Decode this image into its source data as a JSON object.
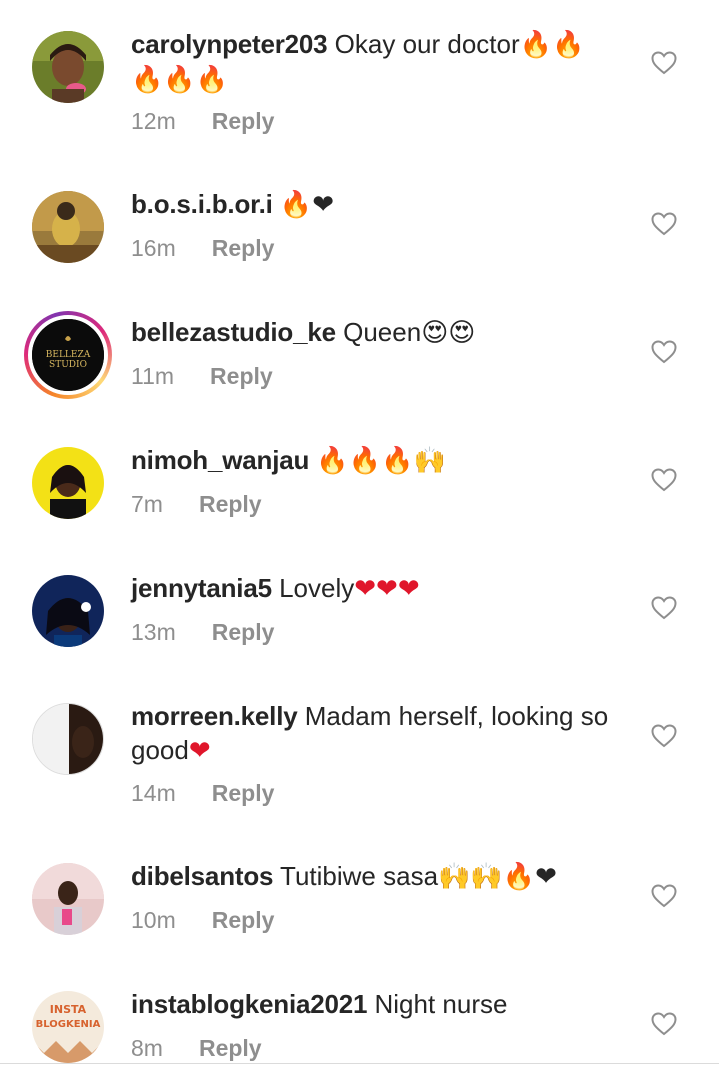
{
  "icons": {
    "like": "heart-outline-icon",
    "fire": "🔥",
    "red_heart": "❤",
    "heart_eyes": "😍",
    "raising_hands": "🙌"
  },
  "colors": {
    "username": "#262626",
    "secondary": "#8e8e8e",
    "heart_red": "#e0162b",
    "fire_orange": "#f7931e"
  },
  "comments": [
    {
      "username": "carolynpeter203",
      "text": " Okay our doctor",
      "emojis_line1": "🔥🔥",
      "emojis_line2": "🔥🔥🔥",
      "time": "12m",
      "reply": "Reply"
    },
    {
      "username": "b.o.s.i.b.or.i",
      "text": " ",
      "emojis": "🔥❤",
      "time": "16m",
      "reply": "Reply"
    },
    {
      "username": "bellezastudio_ke",
      "text": " Queen",
      "emojis": "😍😍",
      "avatar_text_1": "BELLEZA",
      "avatar_text_2": "STUDIO",
      "time": "11m",
      "reply": "Reply"
    },
    {
      "username": "nimoh_wanjau",
      "text": " ",
      "emojis": "🔥🔥🔥🙌",
      "time": "7m",
      "reply": "Reply"
    },
    {
      "username": "jennytania5",
      "text": " Lovely",
      "emojis": "❤❤❤",
      "time": "13m",
      "reply": "Reply"
    },
    {
      "username": "morreen.kelly",
      "text": " Madam herself, looking so good",
      "emojis": "❤",
      "time": "14m",
      "reply": "Reply"
    },
    {
      "username": "dibelsantos",
      "text": " Tutibiwe sasa",
      "emojis": "🙌🙌🔥❤",
      "time": "10m",
      "reply": "Reply"
    },
    {
      "username": "instablogkenia2021",
      "text": " Night nurse",
      "avatar_text_1": "INSTA",
      "avatar_text_2": "BLOGKENIA",
      "time": "8m",
      "reply": "Reply"
    }
  ]
}
